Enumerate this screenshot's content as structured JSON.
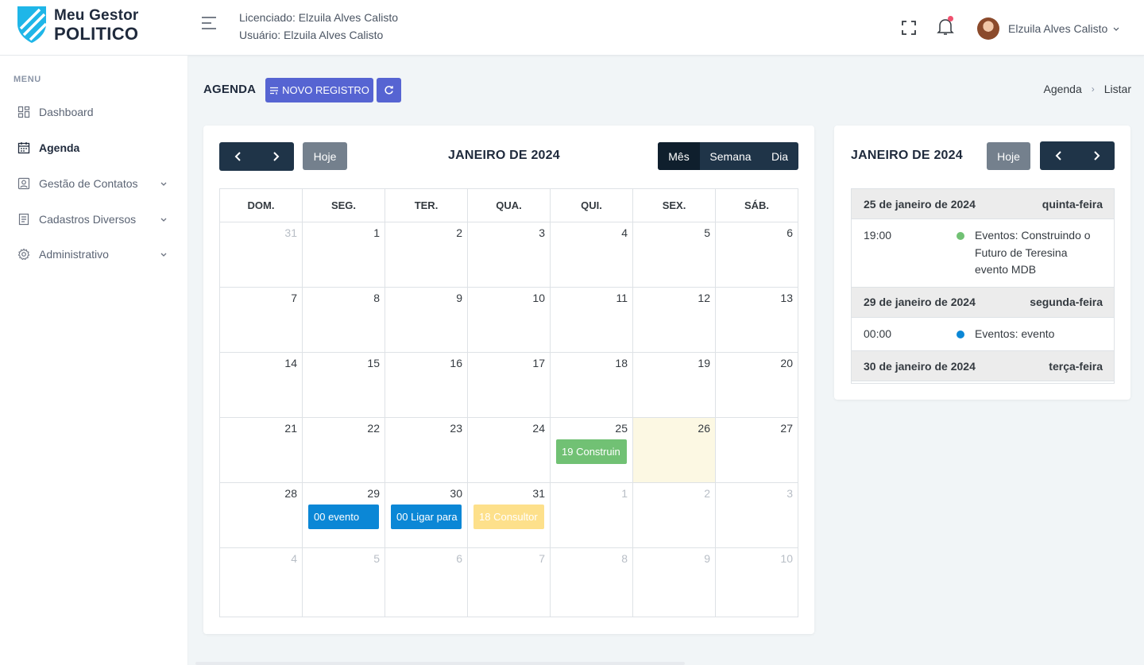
{
  "brand": {
    "line1": "Meu Gestor",
    "line2": "POLITICO"
  },
  "header": {
    "licensee": "Licenciado: Elzuila Alves Calisto",
    "user_line": "Usuário: Elzuila Alves Calisto",
    "user_name": "Elzuila Alves Calisto"
  },
  "sidebar": {
    "title": "MENU",
    "items": [
      {
        "label": "Dashboard",
        "icon": "dashboard-icon"
      },
      {
        "label": "Agenda",
        "icon": "calendar-icon",
        "active": true
      },
      {
        "label": "Gestão de Contatos",
        "icon": "contacts-icon",
        "has_children": true
      },
      {
        "label": "Cadastros Diversos",
        "icon": "form-icon",
        "has_children": true
      },
      {
        "label": "Administrativo",
        "icon": "gear-icon",
        "has_children": true
      }
    ]
  },
  "page": {
    "title": "AGENDA",
    "new_button": "NOVO REGISTRO",
    "breadcrumb": [
      "Agenda",
      "Listar"
    ]
  },
  "calendar": {
    "title": "JANEIRO DE 2024",
    "today_label": "Hoje",
    "views": [
      "Mês",
      "Semana",
      "Dia"
    ],
    "active_view": "Mês",
    "weekdays": [
      "DOM.",
      "SEG.",
      "TER.",
      "QUA.",
      "QUI.",
      "SEX.",
      "SÁB."
    ],
    "weeks": [
      [
        {
          "d": "31",
          "o": true
        },
        {
          "d": "1"
        },
        {
          "d": "2"
        },
        {
          "d": "3"
        },
        {
          "d": "4"
        },
        {
          "d": "5"
        },
        {
          "d": "6"
        }
      ],
      [
        {
          "d": "7"
        },
        {
          "d": "8"
        },
        {
          "d": "9"
        },
        {
          "d": "10"
        },
        {
          "d": "11"
        },
        {
          "d": "12"
        },
        {
          "d": "13"
        }
      ],
      [
        {
          "d": "14"
        },
        {
          "d": "15"
        },
        {
          "d": "16"
        },
        {
          "d": "17"
        },
        {
          "d": "18"
        },
        {
          "d": "19"
        },
        {
          "d": "20"
        }
      ],
      [
        {
          "d": "21"
        },
        {
          "d": "22"
        },
        {
          "d": "23"
        },
        {
          "d": "24"
        },
        {
          "d": "25",
          "evt": {
            "text": "19 Construin",
            "color": "#71c174"
          }
        },
        {
          "d": "26",
          "today": true
        },
        {
          "d": "27"
        }
      ],
      [
        {
          "d": "28"
        },
        {
          "d": "29",
          "evt": {
            "text": "00 evento",
            "color": "#0b87d6"
          }
        },
        {
          "d": "30",
          "evt": {
            "text": "00 Ligar para",
            "color": "#0b87d6"
          }
        },
        {
          "d": "31",
          "evt": {
            "text": "18 Consultor",
            "color": "#fde08b"
          }
        },
        {
          "d": "1",
          "o": true
        },
        {
          "d": "2",
          "o": true
        },
        {
          "d": "3",
          "o": true
        }
      ],
      [
        {
          "d": "4",
          "o": true
        },
        {
          "d": "5",
          "o": true
        },
        {
          "d": "6",
          "o": true
        },
        {
          "d": "7",
          "o": true
        },
        {
          "d": "8",
          "o": true
        },
        {
          "d": "9",
          "o": true
        },
        {
          "d": "10",
          "o": true
        }
      ]
    ]
  },
  "list": {
    "title": "JANEIRO DE 2024",
    "today_label": "Hoje",
    "days": [
      {
        "date": "25 de janeiro de 2024",
        "weekday": "quinta-feira",
        "events": [
          {
            "time": "19:00",
            "title": "Eventos: Construindo o Futuro de Teresina evento MDB",
            "color": "#71c174"
          }
        ]
      },
      {
        "date": "29 de janeiro de 2024",
        "weekday": "segunda-feira",
        "events": [
          {
            "time": "00:00",
            "title": "Eventos: evento",
            "color": "#0b87d6"
          }
        ]
      },
      {
        "date": "30 de janeiro de 2024",
        "weekday": "terça-feira",
        "events": []
      }
    ]
  },
  "colors": {
    "accent": "#5664d2",
    "nav_dark": "#1f3448",
    "brand_blue": "#1fb6e8"
  }
}
